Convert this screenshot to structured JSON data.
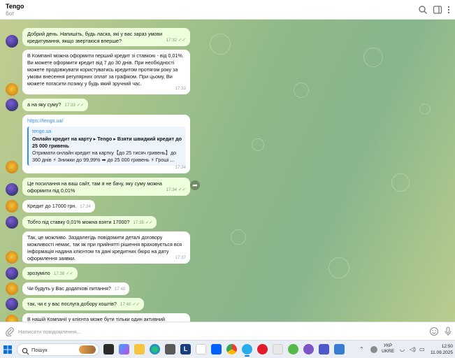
{
  "header": {
    "title": "Tengo",
    "subtitle": "бот"
  },
  "messages": [
    {
      "from": "bot",
      "text": "Добрий день. Напишіть, будь ласка, які у вас зараз умови кредитування, якщо звертаюся вперше?",
      "time": "17:32"
    },
    {
      "from": "user",
      "text": "В Компанії можна оформити перший кредит зі ставкою - від 0,01%. Ви можете оформити кредит від 7 до 30 днів. При необхідності можете продовжувати користуватись кредитом протягом року за умови внесення регулярних оплат за графіком. При цьому, Ви можете погасити позику у будь який зручний час.",
      "time": "17:33"
    },
    {
      "from": "bot",
      "text": "а на яку суму?",
      "time": "17:33"
    },
    {
      "from": "user",
      "link": "https://tengo.ua/",
      "preview": {
        "site": "tengo.ua",
        "title": "Онлайн кредит на карту ▸ Tengo ▸ Взяти швидкий кредит до 25 000 гривень",
        "desc": "Отримати онлайн кредит на картку【до 25 тисяч гривень】до 360 днів ⚡ Знижки до 99,99% ➡ до 25 000 гривень ⚡ Гроші ..."
      },
      "time": "17:34"
    },
    {
      "from": "bot",
      "text": "Це посилання на ваш сайт, там я не бачу, яку суму можна оформити під 0,01%",
      "time": "17:34"
    },
    {
      "from": "user",
      "text": "Кредит до 17000 грн.",
      "time": "17:34"
    },
    {
      "from": "bot",
      "text": "Тобто під ставку 0,01% можна взяти 17000?",
      "time": "17:35"
    },
    {
      "from": "user",
      "text": "Так, це можливо. Заздалегідь повідомити деталі договору можливості немає, так як при прийнятті рішення враховується вся інформація надана клієнтом та дані кредитних бюро на дату оформлення заявки.",
      "time": "17:37"
    },
    {
      "from": "bot",
      "text": "зрозуміло",
      "time": "17:38"
    },
    {
      "from": "user",
      "text": "Чи будуть у Вас додаткові питання?",
      "time": "17:40"
    },
    {
      "from": "bot",
      "text": "так, чи є у вас послуга добору коштів?",
      "time": "17:40"
    },
    {
      "from": "user",
      "text": "В нашій Компанії у клієнта може бути тільки один активний",
      "time": ""
    }
  ],
  "composer": {
    "placeholder": "Написати повідомлення..."
  },
  "taskbar": {
    "search_label": "Пошук",
    "lang_line1": "УКР",
    "lang_line2": "UKRE",
    "time": "12:50",
    "date": "11.09.2025"
  },
  "colors": {
    "incoming_bg": "#ffffff",
    "outgoing_bg": "#eeffde",
    "link": "#3390ec",
    "check": "#5fb35b"
  }
}
